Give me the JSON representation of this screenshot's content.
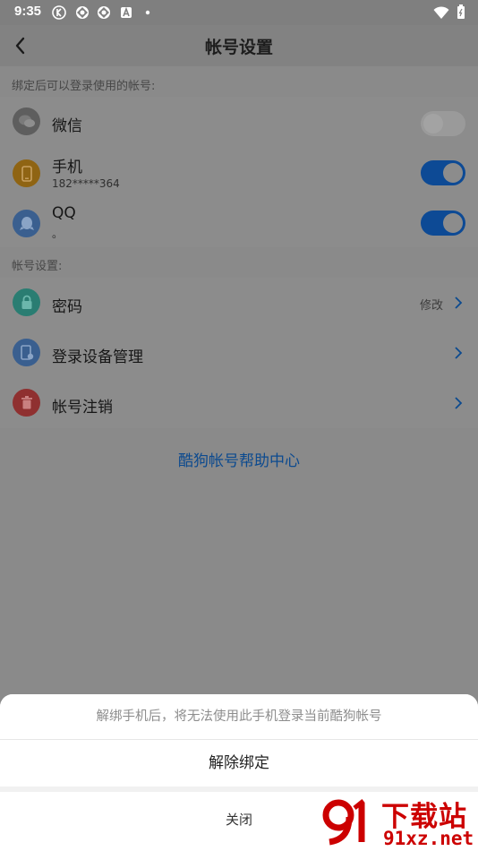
{
  "status_bar": {
    "time": "9:35"
  },
  "header": {
    "title": "帐号设置"
  },
  "bound_section": {
    "label": "绑定后可以登录使用的帐号:",
    "items": [
      {
        "label": "微信",
        "sub": "",
        "icon": "wechat-icon",
        "enabled": false
      },
      {
        "label": "手机",
        "sub": "182*****364",
        "icon": "phone-icon",
        "enabled": true
      },
      {
        "label": "QQ",
        "sub": "。",
        "icon": "qq-icon",
        "enabled": true
      }
    ]
  },
  "account_section": {
    "label": "帐号设置:",
    "items": [
      {
        "label": "密码",
        "action": "修改",
        "icon": "lock-icon"
      },
      {
        "label": "登录设备管理",
        "action": "",
        "icon": "device-icon"
      },
      {
        "label": "帐号注销",
        "action": "",
        "icon": "trash-icon"
      }
    ]
  },
  "help_link": "酷狗帐号帮助中心",
  "sheet": {
    "message": "解绑手机后，将无法使用此手机登录当前酷狗帐号",
    "confirm": "解除绑定",
    "close": "关闭"
  },
  "watermark": {
    "text": "下载站",
    "url": "91xz.net"
  },
  "colors": {
    "accent": "#0d4a95",
    "wechat": "#5e5e5e",
    "phone": "#8f6413",
    "qq": "#3a5f8f",
    "lock": "#2a7d72",
    "device": "#3a5f8f",
    "trash": "#8f3030"
  }
}
